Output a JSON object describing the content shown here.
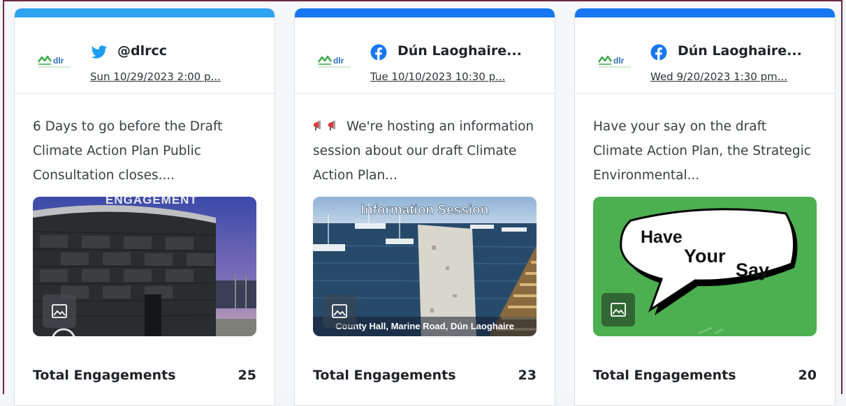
{
  "colors": {
    "topbar_twitter": "#2ea3f2",
    "topbar_facebook": "#1877f2",
    "twitter_blue": "#1d9bf0",
    "facebook_blue": "#1877f2",
    "logo_green": "#3aa547",
    "logo_blue": "#2a6fb5",
    "image_green": "#4caf50"
  },
  "cards": [
    {
      "network_icon": "twitter-icon",
      "logo_text": "dlr",
      "account": "@dlrcc",
      "date": "Sun 10/29/2023 2:00 p...",
      "text": "6 Days to go before the Draft Climate Action Plan Public Consultation closes....",
      "image_text": "ENGAGEMENT",
      "engagements_label": "Total Engagements",
      "engagements_value": "25"
    },
    {
      "network_icon": "facebook-icon",
      "logo_text": "dlr",
      "account": "Dún Laoghaire...",
      "date": "Tue 10/10/2023 10:30 p...",
      "text": " We're hosting an information session about our draft Climate Action Plan...",
      "image_title": "Information Session",
      "image_caption": "County Hall, Marine Road, Dún Laoghaire",
      "engagements_label": "Total Engagements",
      "engagements_value": "23"
    },
    {
      "network_icon": "facebook-icon",
      "logo_text": "dlr",
      "account": "Dún Laoghaire...",
      "date": "Wed 9/20/2023 1:30 pm...",
      "text": "Have your say on the draft Climate Action Plan, the Strategic Environmental...",
      "bubble_line1": "Have",
      "bubble_line2": "Your",
      "bubble_line3": "Say",
      "engagements_label": "Total Engagements",
      "engagements_value": "20"
    }
  ]
}
